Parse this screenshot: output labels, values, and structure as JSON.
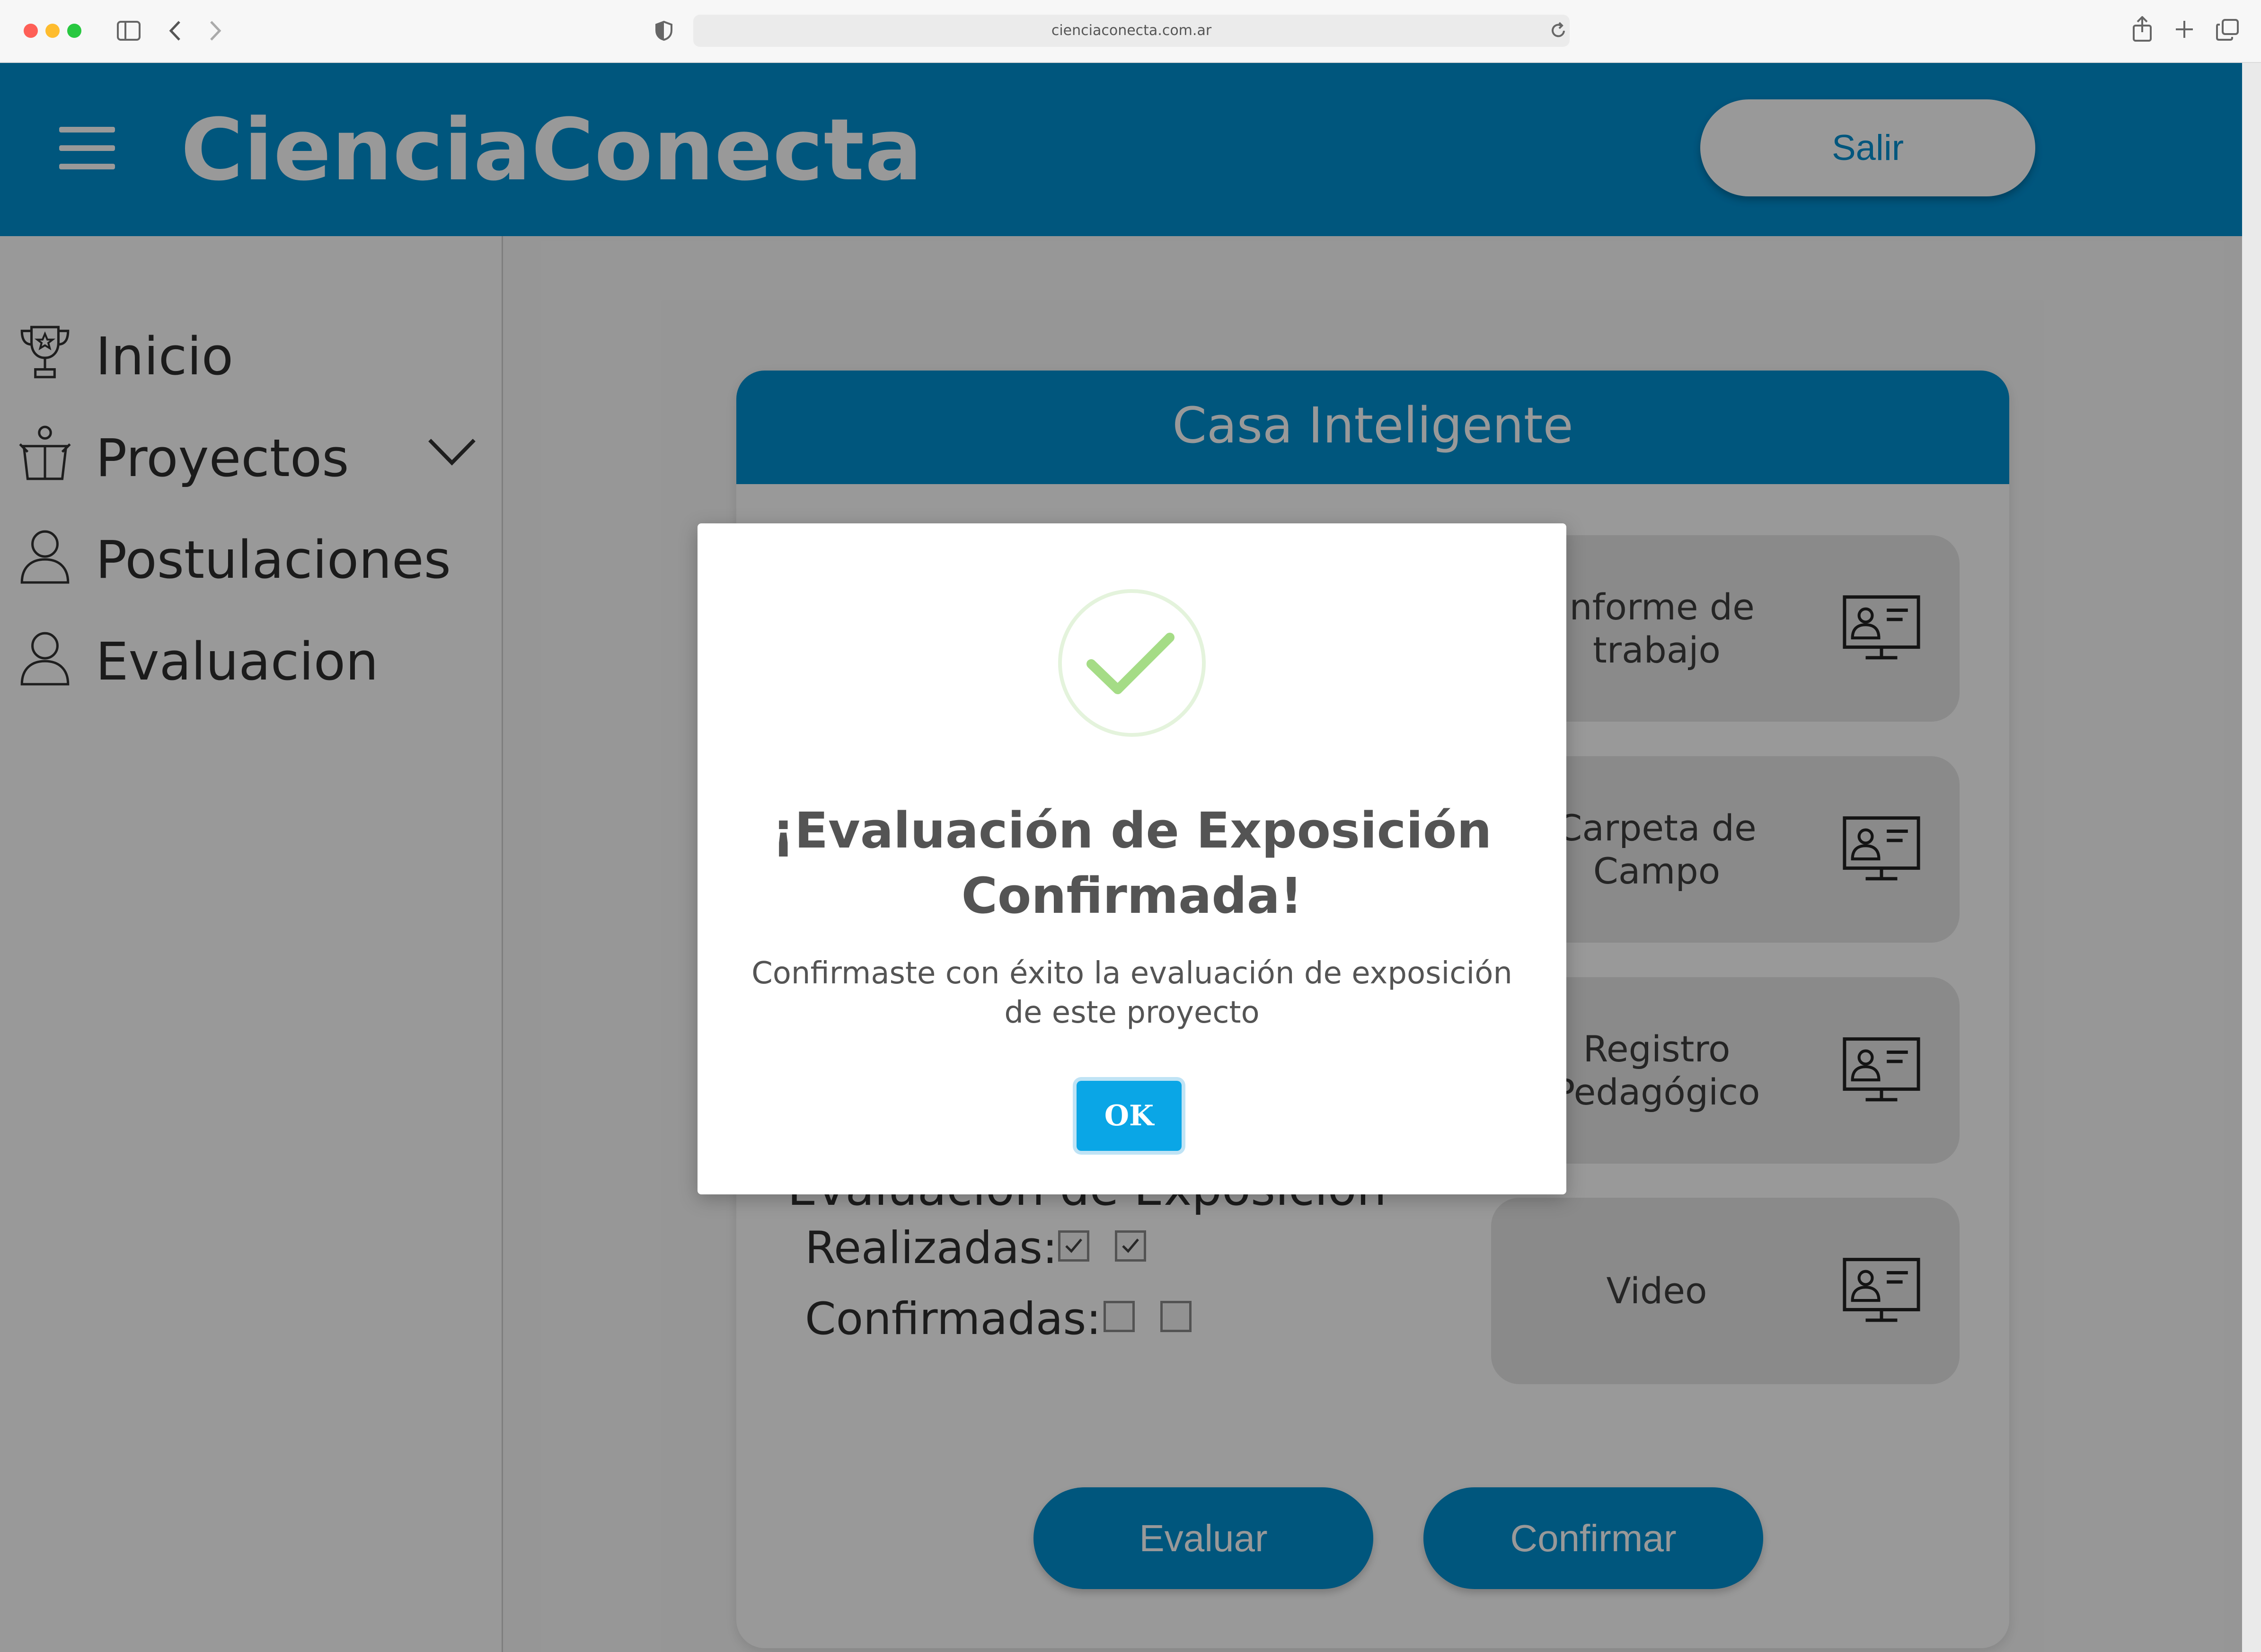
{
  "browser": {
    "url": "cienciaconecta.com.ar"
  },
  "header": {
    "brand": "CienciaConecta",
    "logout_label": "Salir"
  },
  "sidebar": {
    "items": [
      {
        "label": "Inicio",
        "icon": "trophy-icon"
      },
      {
        "label": "Proyectos",
        "icon": "presenter-icon",
        "expandable": true
      },
      {
        "label": "Postulaciones",
        "icon": "user-icon"
      },
      {
        "label": "Evaluacion",
        "icon": "user-icon"
      }
    ]
  },
  "project": {
    "title": "Casa Inteligente",
    "documents": [
      {
        "label": "Informe de trabajo",
        "icon": "presentation-screen-icon"
      },
      {
        "label": "Carpeta de Campo",
        "icon": "presentation-screen-icon"
      },
      {
        "label": "Registro Pedagógico",
        "icon": "presentation-screen-icon"
      },
      {
        "label": "Video",
        "icon": "presentation-screen-icon"
      }
    ],
    "section_title": "Evaluación de Exposición",
    "realizadas_label": "Realizadas:",
    "realizadas": [
      true,
      true
    ],
    "confirmadas_label": "Confirmadas:",
    "confirmadas": [
      false,
      false
    ],
    "evaluate_label": "Evaluar",
    "confirm_label": "Confirmar"
  },
  "modal": {
    "title": "¡Evaluación de Exposición Confirmada!",
    "text": "Confirmaste con éxito la evaluación de exposición de este proyecto",
    "ok_label": "OK",
    "icon": "success-check-icon"
  },
  "colors": {
    "primary": "#008fd1",
    "success": "#a5dc86",
    "ok_button": "#0aa6e6"
  }
}
